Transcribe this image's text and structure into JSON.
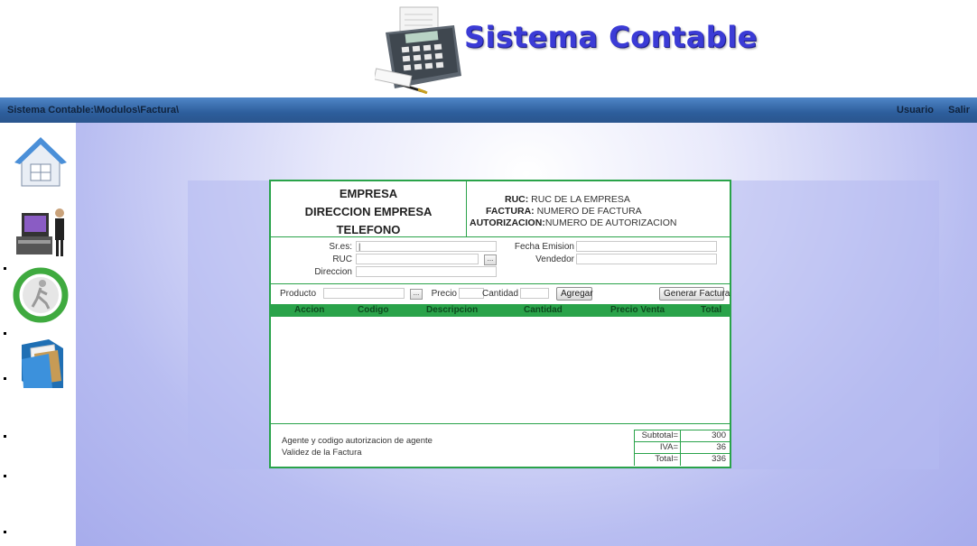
{
  "header": {
    "app_title": "Sistema Contable",
    "logo_icon": "calculator-icon"
  },
  "navbar": {
    "breadcrumb": "Sistema Contable:\\Modulos\\Factura\\",
    "user_label": "Usuario",
    "exit_label": "Salir"
  },
  "sidebar": {
    "items": [
      {
        "icon": "home-icon"
      },
      {
        "icon": "cash-register-icon"
      },
      {
        "icon": "refresh-runner-icon"
      },
      {
        "icon": "folder-files-icon"
      }
    ]
  },
  "invoice": {
    "company": {
      "name": "EMPRESA",
      "address": "DIRECCION EMPRESA",
      "phone": "TELEFONO"
    },
    "ruc": {
      "label": "RUC:",
      "value": "RUC DE LA EMPRESA"
    },
    "factura": {
      "label": "FACTURA:",
      "value": "NUMERO DE FACTURA"
    },
    "autorizacion": {
      "label": "AUTORIZACION:",
      "value": "NUMERO DE AUTORIZACION"
    },
    "client": {
      "sres_label": "Sr.es:",
      "sres_value": "|",
      "ruc_label": "RUC",
      "ruc_value": "",
      "direccion_label": "Direccion",
      "direccion_value": "",
      "fecha_label": "Fecha Emision",
      "fecha_value": "",
      "vendedor_label": "Vendedor",
      "vendedor_value": "",
      "dots_label": "..."
    },
    "product_bar": {
      "producto_label": "Producto",
      "producto_value": "",
      "precio_label": "Precio",
      "precio_value": "",
      "cantidad_label": "Cantidad",
      "cantidad_value": "",
      "agregar_label": "Agregar",
      "generar_label": "Generar Factura",
      "dots_label": "..."
    },
    "columns": [
      "Accion",
      "Codigo",
      "Descripcion",
      "Cantidad",
      "Precio Venta",
      "Total"
    ],
    "rows": [],
    "footer": {
      "agent_text": "Agente y codigo autorizacion de agente",
      "validity_text": "Validez de la Factura"
    },
    "totals": [
      {
        "label": "Subtotal=",
        "value": "300"
      },
      {
        "label": "IVA=",
        "value": "36"
      },
      {
        "label": "Total=",
        "value": "336"
      }
    ]
  }
}
